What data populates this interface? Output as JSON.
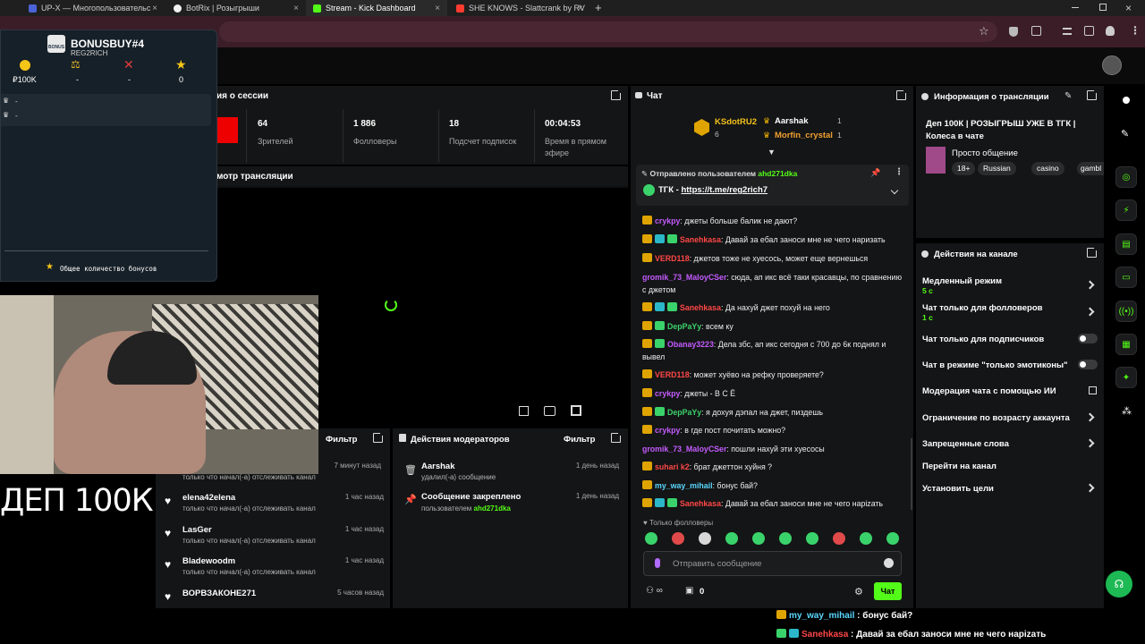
{
  "browser": {
    "tabs": [
      {
        "title": "UP-X — Многопользовательс",
        "color": "#4b63d8"
      },
      {
        "title": "BotRix | Розыгрыши",
        "color": "#f0f0f0"
      },
      {
        "title": "Stream - Kick Dashboard",
        "color": "#53fc18"
      },
      {
        "title": "SHE KNOWS - Slattcrank by RV",
        "color": "#ff3b30"
      }
    ],
    "new_tab": "+",
    "close": "×"
  },
  "overlay": {
    "title": "BONUSBUY#4",
    "subtitle": "REG2RICH",
    "gift_label": "BONUS",
    "stats": [
      {
        "value": "₽100K"
      },
      {
        "value": "-"
      },
      {
        "value": "-"
      },
      {
        "value": "0"
      }
    ],
    "rows": [
      "-",
      "-"
    ],
    "footer": "Общее количество бонусов",
    "banner": "ДЕП 100К"
  },
  "session": {
    "title": "ия о сессии",
    "stats": [
      {
        "value": "64",
        "label": "Зрителей"
      },
      {
        "value": "1 886",
        "label": "Фолловеры"
      },
      {
        "value": "18",
        "label": "Подсчет подписок"
      },
      {
        "value": "00:04:53",
        "label": "Время в прямом эфире"
      }
    ]
  },
  "preview": {
    "title": "мотр трансляции"
  },
  "followers": {
    "filter": "Фильтр",
    "first_time": "7 минут назад",
    "first_text": "только что начал(-а) отслеживать канал",
    "items": [
      {
        "name": "elena42elena",
        "time": "1 час назад",
        "text": "только что начал(-а) отслеживать канал"
      },
      {
        "name": "LasGer",
        "time": "1 час назад",
        "text": "только что начал(-а) отслеживать канал"
      },
      {
        "name": "Bladewoodm",
        "time": "1 час назад",
        "text": "только что начал(-а) отслеживать канал"
      },
      {
        "name": "ВОРВЗАКОНЕ271",
        "time": "5 часов назад",
        "text": ""
      }
    ]
  },
  "modactions": {
    "title": "Действия модераторов",
    "filter": "Фильтр",
    "items": [
      {
        "name": "Aarshak",
        "time": "1 день назад",
        "text": "удалил(-а) сообщение",
        "user": ""
      },
      {
        "name": "Сообщение закреплено",
        "time": "1 день назад",
        "text": "пользователем ",
        "user": "ahd271dka"
      }
    ]
  },
  "chat": {
    "title": "Чат",
    "top": [
      {
        "name": "KSdotRU2",
        "count": "6"
      },
      {
        "name": "Aarshak",
        "count": "1"
      },
      {
        "name": "Morfin_crystal",
        "count": "1"
      }
    ],
    "pinned_by": "Отправлено пользователем",
    "pinned_user": "ahd271dka",
    "pinned_label": "ТГК - ",
    "pinned_link": "https://t.me/reg2rich7",
    "messages": [
      {
        "user": "crykpy",
        "color": "#c45cff",
        "text": ": джеты больше балик не дают?",
        "b": "c"
      },
      {
        "user": "Sanehkasa",
        "color": "#ff4747",
        "text": ": Давай за ебал заноси мне не чего наризать",
        "b": "ctg"
      },
      {
        "user": "VERD118",
        "color": "#ff4747",
        "text": ": джетов тоже не хуесось, может еще вернешься",
        "b": "c"
      },
      {
        "user": "gromik_73_MaloyCSer",
        "color": "#c45cff",
        "text": ": сюда, ап икс всё таки красавцы, по сравнению с джетом",
        "b": ""
      },
      {
        "user": "Sanehkasa",
        "color": "#ff4747",
        "text": ": Да нахуй джет похуй на него",
        "b": "ctg"
      },
      {
        "user": "DepPaYy",
        "color": "#3ad36b",
        "text": ": всем ку",
        "b": "cg"
      },
      {
        "user": "Obanay3223",
        "color": "#c45cff",
        "text": ": Дела збс, ап икс сегодня с 700 до 6к поднял и вывел",
        "b": "cg"
      },
      {
        "user": "VERD118",
        "color": "#ff4747",
        "text": ": может хуёво на рефку проверяете?",
        "b": "c"
      },
      {
        "user": "crykpy",
        "color": "#c45cff",
        "text": ": джеты - В С Ё",
        "b": "c"
      },
      {
        "user": "DepPaYy",
        "color": "#3ad36b",
        "text": ": я дохуя дэпал на джет, пиздешь",
        "b": "cg"
      },
      {
        "user": "crykpy",
        "color": "#c45cff",
        "text": ": в где пост почитать можно?",
        "b": "c"
      },
      {
        "user": "gromik_73_MaloyCSer",
        "color": "#c45cff",
        "text": ": пошли нахуй эти хуесосы",
        "b": ""
      },
      {
        "user": "suhari k2",
        "color": "#ff4747",
        "text": ": брат джеттон хуйня ?",
        "b": "c"
      },
      {
        "user": "my_way_mihail",
        "color": "#5ad8ff",
        "text": ": бонус бай?",
        "b": "c"
      },
      {
        "user": "Sanehkasa",
        "color": "#ff4747",
        "text": ": Давай за ебал заноси мне не чего нарizать",
        "b": "ctg"
      }
    ],
    "followers_only": "Только фолловеры",
    "placeholder": "Отправить сообщение",
    "count": "0",
    "send": "Чат"
  },
  "info": {
    "title": "Информация о трансляции",
    "stream_title": "Деп 100К | РОЗЫГРЫШ УЖЕ В ТГК | Колеса в чате",
    "category": "Просто общение",
    "tags": [
      "18+",
      "Russian",
      "casino",
      "gambl"
    ]
  },
  "actions": {
    "title": "Действия на канале",
    "items": [
      {
        "label": "Медленный режим",
        "sub": "5 с"
      },
      {
        "label": "Чат только для фолловеров",
        "sub": "1 с"
      },
      {
        "label": "Чат только для подписчиков",
        "sub": ""
      },
      {
        "label": "Чат в режиме \"только эмотиконы\"",
        "sub": ""
      },
      {
        "label": "Модерация чата с помощью ИИ",
        "sub": ""
      },
      {
        "label": "Ограничение по возрасту аккаунта",
        "sub": ""
      },
      {
        "label": "Запрещенные слова",
        "sub": ""
      },
      {
        "label": "Перейти на канал",
        "sub": ""
      },
      {
        "label": "Установить цели",
        "sub": ""
      }
    ]
  },
  "stream_overlay_chat": [
    {
      "user": "my_way_mihail",
      "color": "#5ad8ff",
      "text": " : бонус бай?"
    },
    {
      "user": "Sanehkasa",
      "color": "#ff4747",
      "text": " : Давай за ебал заноси мне не чего нарizать"
    }
  ],
  "colors": {
    "accent": "#53fc18",
    "bg": "#0b0b0c",
    "panel": "#141516"
  }
}
